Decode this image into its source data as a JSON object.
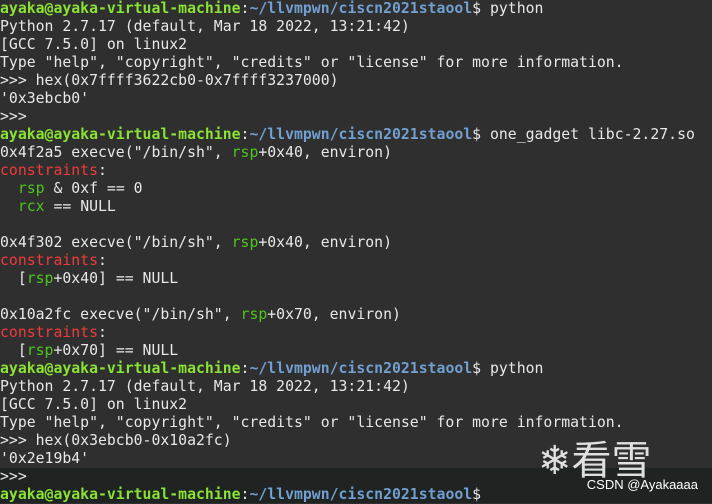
{
  "colors": {
    "background": "#2f2f2f",
    "user": "#8ae234",
    "path": "#729fcf",
    "register": "#4ec61e",
    "constraint": "#ef3b3b",
    "text": "#e8e8e8"
  },
  "terminal": {
    "lines": [
      [
        {
          "t": "ayaka@ayaka-virtual-machine",
          "c": "user"
        },
        {
          "t": ":",
          "c": "plain"
        },
        {
          "t": "~/llvmpwn/ciscn2021staool",
          "c": "path"
        },
        {
          "t": "$ python",
          "c": "plain"
        }
      ],
      [
        {
          "t": "Python 2.7.17 (default, Mar 18 2022, 13:21:42)",
          "c": "plain"
        }
      ],
      [
        {
          "t": "[GCC 7.5.0] on linux2",
          "c": "plain"
        }
      ],
      [
        {
          "t": "Type \"help\", \"copyright\", \"credits\" or \"license\" for more information.",
          "c": "plain"
        }
      ],
      [
        {
          "t": ">>> hex(0x7ffff3622cb0-0x7ffff3237000)",
          "c": "plain"
        }
      ],
      [
        {
          "t": "'0x3ebcb0'",
          "c": "plain"
        }
      ],
      [
        {
          "t": ">>>",
          "c": "plain"
        }
      ],
      [
        {
          "t": "ayaka@ayaka-virtual-machine",
          "c": "user"
        },
        {
          "t": ":",
          "c": "plain"
        },
        {
          "t": "~/llvmpwn/ciscn2021staool",
          "c": "path"
        },
        {
          "t": "$ one_gadget libc-2.27.so",
          "c": "plain"
        }
      ],
      [
        {
          "t": "0x4f2a5 execve(\"/bin/sh\", ",
          "c": "plain"
        },
        {
          "t": "rsp",
          "c": "reg"
        },
        {
          "t": "+0x40, environ)",
          "c": "plain"
        }
      ],
      [
        {
          "t": "constraints",
          "c": "red"
        },
        {
          "t": ":",
          "c": "plain"
        }
      ],
      [
        {
          "t": "  ",
          "c": "plain"
        },
        {
          "t": "rsp",
          "c": "reg"
        },
        {
          "t": " & 0xf == 0",
          "c": "plain"
        }
      ],
      [
        {
          "t": "  ",
          "c": "plain"
        },
        {
          "t": "rcx",
          "c": "reg"
        },
        {
          "t": " == NULL",
          "c": "plain"
        }
      ],
      [],
      [
        {
          "t": "0x4f302 execve(\"/bin/sh\", ",
          "c": "plain"
        },
        {
          "t": "rsp",
          "c": "reg"
        },
        {
          "t": "+0x40, environ)",
          "c": "plain"
        }
      ],
      [
        {
          "t": "constraints",
          "c": "red"
        },
        {
          "t": ":",
          "c": "plain"
        }
      ],
      [
        {
          "t": "  [",
          "c": "plain"
        },
        {
          "t": "rsp",
          "c": "reg"
        },
        {
          "t": "+0x40] == NULL",
          "c": "plain"
        }
      ],
      [],
      [
        {
          "t": "0x10a2fc execve(\"/bin/sh\", ",
          "c": "plain"
        },
        {
          "t": "rsp",
          "c": "reg"
        },
        {
          "t": "+0x70, environ)",
          "c": "plain"
        }
      ],
      [
        {
          "t": "constraints",
          "c": "red"
        },
        {
          "t": ":",
          "c": "plain"
        }
      ],
      [
        {
          "t": "  [",
          "c": "plain"
        },
        {
          "t": "rsp",
          "c": "reg"
        },
        {
          "t": "+0x70] == NULL",
          "c": "plain"
        }
      ],
      [
        {
          "t": "ayaka@ayaka-virtual-machine",
          "c": "user"
        },
        {
          "t": ":",
          "c": "plain"
        },
        {
          "t": "~/llvmpwn/ciscn2021staool",
          "c": "path"
        },
        {
          "t": "$ python",
          "c": "plain"
        }
      ],
      [
        {
          "t": "Python 2.7.17 (default, Mar 18 2022, 13:21:42)",
          "c": "plain"
        }
      ],
      [
        {
          "t": "[GCC 7.5.0] on linux2",
          "c": "plain"
        }
      ],
      [
        {
          "t": "Type \"help\", \"copyright\", \"credits\" or \"license\" for more information.",
          "c": "plain"
        }
      ],
      [
        {
          "t": ">>> hex(0x3ebcb0-0x10a2fc)",
          "c": "plain"
        }
      ],
      [
        {
          "t": "'0x2e19b4'",
          "c": "plain"
        }
      ],
      [
        {
          "t": ">>>",
          "c": "plain"
        }
      ],
      [
        {
          "t": "ayaka@ayaka-virtual-machine",
          "c": "user"
        },
        {
          "t": ":",
          "c": "plain"
        },
        {
          "t": "~/llvmpwn/ciscn2021staool",
          "c": "path"
        },
        {
          "t": "$",
          "c": "plain"
        }
      ]
    ]
  },
  "watermark": {
    "logo": "❄看雪",
    "text": "CSDN @Ayakaaaa"
  }
}
